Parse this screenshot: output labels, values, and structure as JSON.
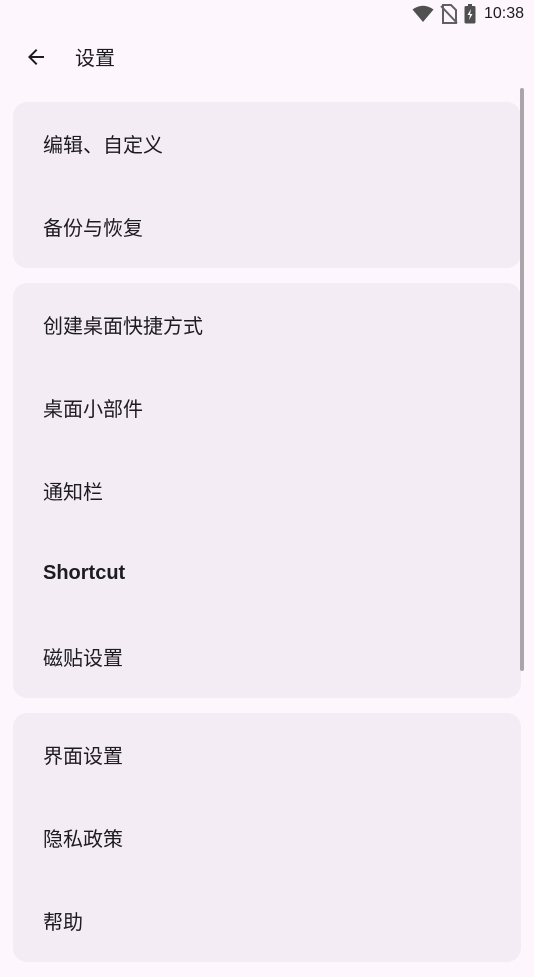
{
  "status_bar": {
    "time": "10:38",
    "icons": [
      "wifi-icon",
      "no-sim-icon",
      "battery-charging-icon"
    ]
  },
  "app_bar": {
    "back_icon": "arrow-left-icon",
    "title": "设置"
  },
  "groups": [
    {
      "items": [
        {
          "label": "编辑、自定义"
        },
        {
          "label": "备份与恢复"
        }
      ]
    },
    {
      "items": [
        {
          "label": "创建桌面快捷方式"
        },
        {
          "label": "桌面小部件"
        },
        {
          "label": "通知栏"
        },
        {
          "label": "Shortcut"
        },
        {
          "label": "磁贴设置"
        }
      ]
    },
    {
      "items": [
        {
          "label": "界面设置"
        },
        {
          "label": "隐私政策"
        },
        {
          "label": "帮助"
        }
      ]
    }
  ],
  "colors": {
    "background": "#fdf7fd",
    "card": "#f4ecf5",
    "text": "#1c1b1f",
    "scrollbar": "#a9a6aa"
  }
}
